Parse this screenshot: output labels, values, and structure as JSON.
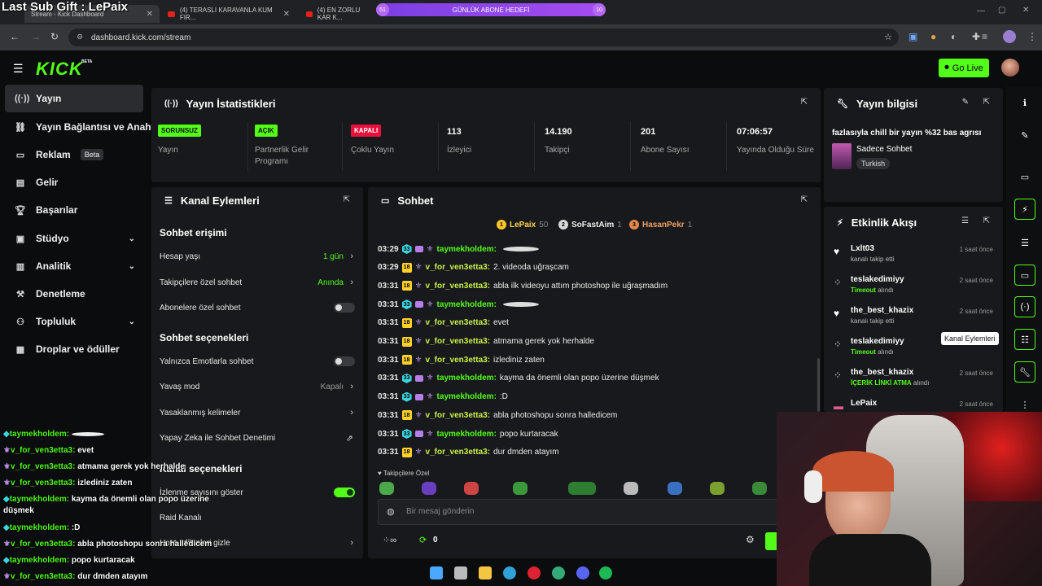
{
  "overlay": {
    "title": "Last Sub Gift : LePaix",
    "goal_label": "GÜNLÜK ABONE HEDEFİ",
    "goal_left": "51",
    "goal_right": "10"
  },
  "browser": {
    "tabs": [
      {
        "label": "Stream - Kick Dashboard"
      },
      {
        "label": "(4) TERASLI KARAVANLA KUM FIR..."
      },
      {
        "label": "(4) EN ZORLU KAR K..."
      }
    ],
    "url": "dashboard.kick.com/stream"
  },
  "header": {
    "logo": "KICK",
    "logo_badge": "BETA",
    "go_live": "Go Live"
  },
  "sidebar": {
    "items": [
      {
        "label": "Yayın",
        "icon": "broadcast-icon"
      },
      {
        "label": "Yayın Bağlantısı ve Anahtarı",
        "icon": "link-icon"
      },
      {
        "label": "Reklam",
        "badge": "Beta",
        "icon": "ad-icon"
      },
      {
        "label": "Gelir",
        "icon": "revenue-icon"
      },
      {
        "label": "Başarılar",
        "icon": "trophy-icon"
      },
      {
        "label": "Stüdyo",
        "icon": "studio-icon"
      },
      {
        "label": "Analitik",
        "icon": "analytics-icon"
      },
      {
        "label": "Denetleme",
        "icon": "hammer-icon"
      },
      {
        "label": "Topluluk",
        "icon": "community-icon"
      },
      {
        "label": "Droplar ve ödüller",
        "icon": "gift-icon"
      }
    ]
  },
  "stats": {
    "title": "Yayın İstatistikleri",
    "items": [
      {
        "badge": "SORUNSUZ",
        "label": "Yayın",
        "color": "#53fc18"
      },
      {
        "badge": "AÇIK",
        "label": "Partnerlik Gelir Programı",
        "color": "#53fc18"
      },
      {
        "badge": "KAPALI",
        "label": "Çoklu Yayın",
        "color": "#e9113c"
      },
      {
        "value": "113",
        "label": "İzleyici"
      },
      {
        "value": "14.190",
        "label": "Takipçi"
      },
      {
        "value": "201",
        "label": "Abone Sayısı"
      },
      {
        "value": "07:06:57",
        "label": "Yayında Olduğu Süre"
      }
    ]
  },
  "info": {
    "title": "Yayın bilgisi",
    "stream_title": "fazlasıyla chill bir yayın %32 bas agrısı",
    "category": "Sadece Sohbet",
    "language": "Turkish"
  },
  "actions": {
    "title": "Kanal Eylemleri",
    "sec1": "Sohbet erişimi",
    "rows1": [
      {
        "label": "Hesap yaşı",
        "value": "1 gün"
      },
      {
        "label": "Takipçilere özel sohbet",
        "value": "Anında"
      },
      {
        "label": "Abonelere özel sohbet"
      }
    ],
    "sec2": "Sohbet seçenekleri",
    "rows2": [
      {
        "label": "Yalnızca Emotlarla sohbet"
      },
      {
        "label": "Yavaş mod",
        "value": "Kapalı"
      },
      {
        "label": "Yasaklanmış kelimeler"
      },
      {
        "label": "Yapay Zeka ile Sohbet Denetimi"
      }
    ],
    "sec3": "Kanal seçenekleri",
    "rows3": [
      {
        "label": "İzlenme sayısını göster"
      },
      {
        "label": "Raid Kanalı"
      },
      {
        "label": "Host edilenleri gizle"
      }
    ]
  },
  "chat": {
    "title": "Sohbet",
    "donors": [
      {
        "name": "LePaix",
        "count": "50"
      },
      {
        "name": "SoFastAim",
        "count": "1"
      },
      {
        "name": "HasanPekr",
        "count": "1"
      }
    ],
    "messages": [
      {
        "time": "03:29",
        "lvl": "33",
        "user": "taymekholdem:",
        "msg": ""
      },
      {
        "time": "03:29",
        "lvl": "18",
        "user": "v_for_ven3etta3:",
        "msg": "2. videoda uğraşcam"
      },
      {
        "time": "03:31",
        "lvl": "18",
        "user": "v_for_ven3etta3:",
        "msg": "abla ilk videoyu attım photoshop ile uğraşmadım"
      },
      {
        "time": "03:31",
        "lvl": "33",
        "user": "taymekholdem:",
        "msg": ""
      },
      {
        "time": "03:31",
        "lvl": "18",
        "user": "v_for_ven3etta3:",
        "msg": "evet"
      },
      {
        "time": "03:31",
        "lvl": "18",
        "user": "v_for_ven3etta3:",
        "msg": "atmama gerek yok herhalde"
      },
      {
        "time": "03:31",
        "lvl": "18",
        "user": "v_for_ven3etta3:",
        "msg": "izlediniz zaten"
      },
      {
        "time": "03:31",
        "lvl": "33",
        "user": "taymekholdem:",
        "msg": "kayma da önemli olan popo üzerine düşmek"
      },
      {
        "time": "03:31",
        "lvl": "33",
        "user": "taymekholdem:",
        "msg": ":D"
      },
      {
        "time": "03:31",
        "lvl": "18",
        "user": "v_for_ven3etta3:",
        "msg": "abla photoshopu sonra halledicem"
      },
      {
        "time": "03:31",
        "lvl": "33",
        "user": "taymekholdem:",
        "msg": "popo kurtaracak"
      },
      {
        "time": "03:31",
        "lvl": "18",
        "user": "v_for_ven3etta3:",
        "msg": "dur dmden atayım"
      }
    ],
    "followers_only": "Takipçilere Özel",
    "placeholder": "Bir mesaj gönderin",
    "points": "0"
  },
  "events": {
    "title": "Etkinlik Akışı",
    "items": [
      {
        "name": "Lxlt03",
        "desc": "kanalı takip etti",
        "time": "1 saat önce",
        "icon": "heart-icon"
      },
      {
        "name": "teslakedimiyy",
        "desc_hl": "Timeout",
        "desc": "alındı",
        "time": "2 saat önce",
        "icon": "mod-icon"
      },
      {
        "name": "the_best_khazix",
        "desc": "kanalı takip etti",
        "time": "2 saat önce",
        "icon": "heart-icon"
      },
      {
        "name": "teslakedimiyy",
        "desc_hl": "Timeout",
        "desc": "alındı",
        "time": "",
        "icon": "mod-icon"
      },
      {
        "name": "the_best_khazix",
        "desc_hl": "İÇERİK LİNKİ ATMA",
        "desc": "alındı",
        "time": "2 saat önce",
        "icon": "mod-icon"
      },
      {
        "name": "LePaix",
        "desc": "",
        "time": "2 saat önce",
        "icon": "gift-icon"
      }
    ]
  },
  "tooltip": "Kanal Eylemleri",
  "overlay_chat": [
    {
      "user": "taymekholdem:",
      "msg": ""
    },
    {
      "user": "v_for_ven3etta3:",
      "msg": "evet"
    },
    {
      "user": "v_for_ven3etta3:",
      "msg": "atmama gerek yok herhalde"
    },
    {
      "user": "v_for_ven3etta3:",
      "msg": "izlediniz zaten"
    },
    {
      "user": "taymekholdem:",
      "msg": "kayma da önemli olan popo üzerine"
    },
    {
      "user": "",
      "msg": "düşmek"
    },
    {
      "user": "taymekholdem:",
      "msg": ":D"
    },
    {
      "user": "v_for_ven3etta3:",
      "msg": "abla photoshopu sonra halledicem"
    },
    {
      "user": "taymekholdem:",
      "msg": "popo kurtaracak"
    },
    {
      "user": "v_for_ven3etta3:",
      "msg": "dur dmden atayım"
    }
  ]
}
